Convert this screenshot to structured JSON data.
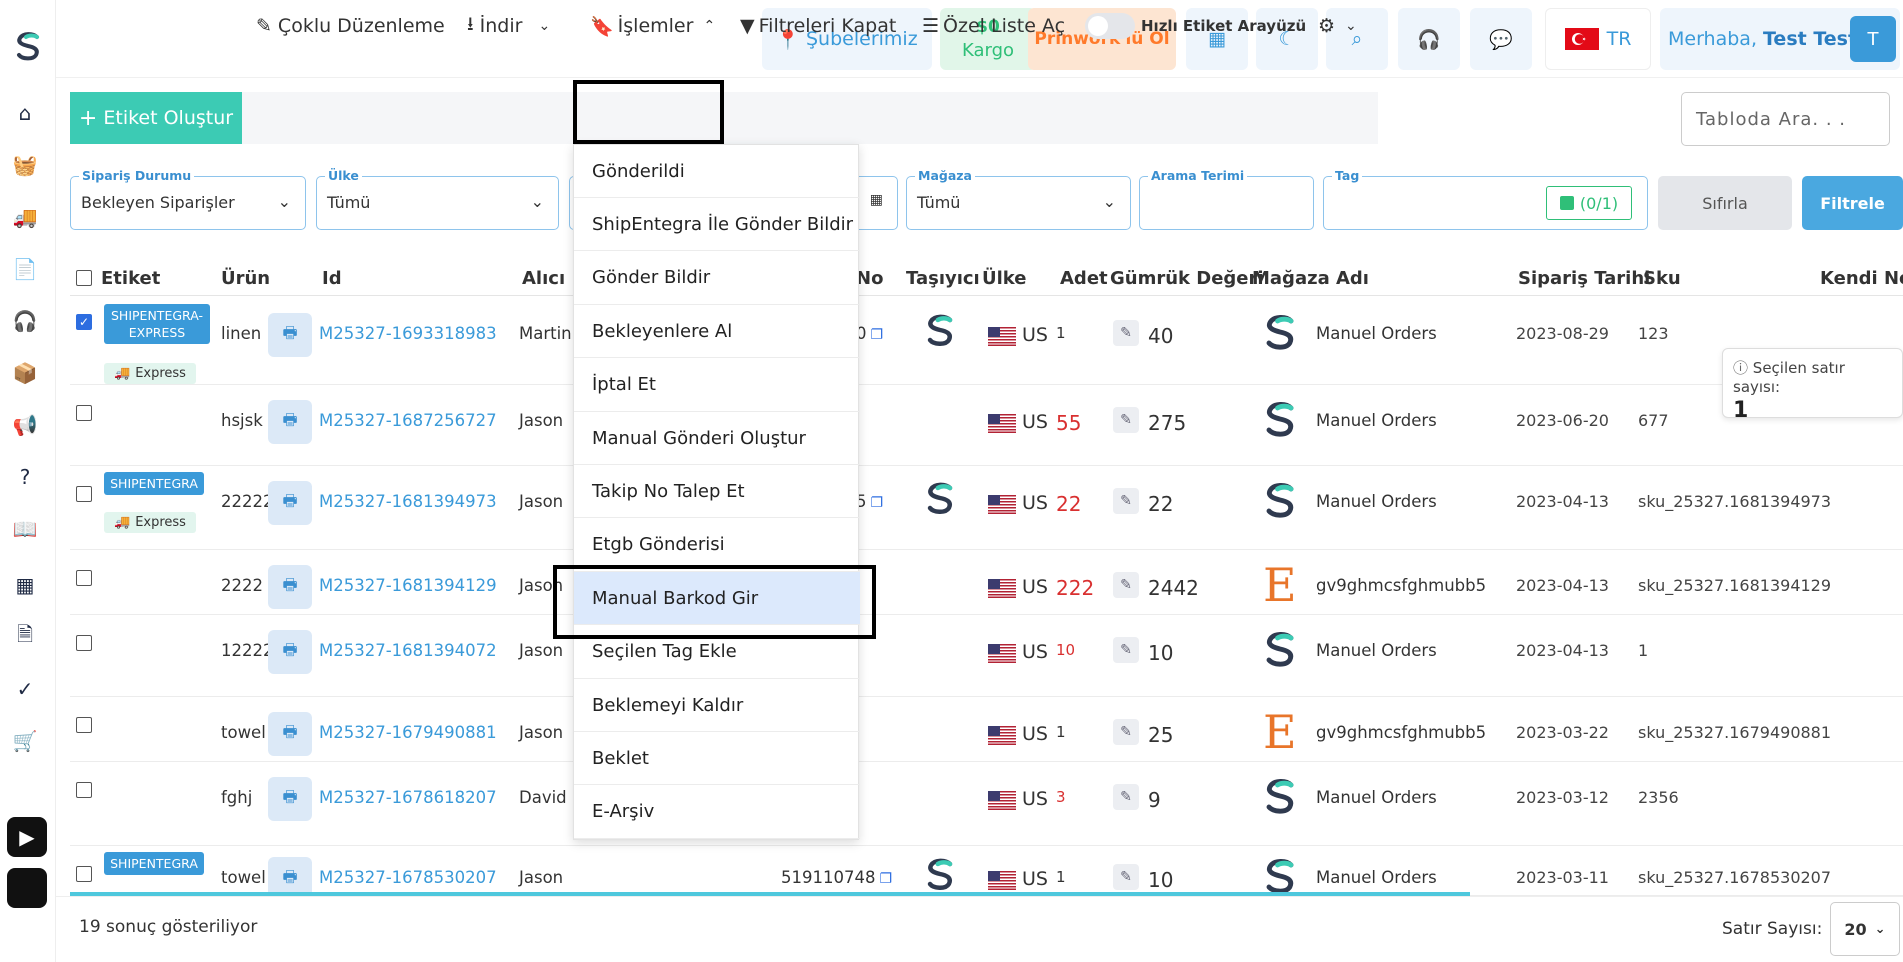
{
  "sidebar": {
    "icons": [
      "logo-icon",
      "home-icon",
      "basket-icon",
      "truck-icon",
      "document-icon",
      "headset-icon",
      "box-icon",
      "megaphone-icon",
      "help-icon",
      "book-icon",
      "calculator-icon",
      "file-icon",
      "check-icon",
      "cart-icon",
      "google-play-icon",
      "apple-icon"
    ]
  },
  "topbar": {
    "branches_label": "Şubelerimiz",
    "cargo_amount": "$0",
    "cargo_label": "Kargo",
    "prinwork_label": "Prinwork'lü Ol",
    "language": "TR",
    "greeting": "Merhaba,",
    "user_name": "Test Test",
    "avatar_initial": "T"
  },
  "toolbar": {
    "create_label": "Etiket Oluştur",
    "bulk_edit_label": "Çoklu Düzenleme",
    "download_label": "İndir",
    "actions_label": "İşlemler",
    "close_filters_label": "Filtreleri Kapat",
    "custom_list_label": "Özel Liste Aç",
    "quick_label_toggle": "Hızlı Etiket Arayüzü",
    "search_placeholder": "Tabloda Ara. . ."
  },
  "filters": {
    "order_status": {
      "label": "Sipariş Durumu",
      "value": "Bekleyen Siparişler"
    },
    "country": {
      "label": "Ülke",
      "value": "Tümü"
    },
    "store": {
      "label": "Mağaza",
      "value": "Tümü"
    },
    "search_term": {
      "label": "Arama Terimi",
      "value": ""
    },
    "tag": {
      "label": "Tag",
      "value": "(0/1)"
    },
    "reset_label": "Sıfırla",
    "filter_label": "Filtrele"
  },
  "table": {
    "headers": {
      "label": "Etiket",
      "product": "Ürün",
      "id": "Id",
      "recipient": "Alıcı",
      "tracking_no": "No",
      "carrier": "Taşıyıcı",
      "country": "Ülke",
      "quantity": "Adet",
      "customs_value": "Gümrük Değeri",
      "store_name": "Mağaza Adı",
      "order_date": "Sipariş Tarihi",
      "sku": "Sku",
      "own_note": "Kendi Not"
    },
    "rows": [
      {
        "checked": true,
        "badge": "SHIPENTEGRA-EXPRESS",
        "express": "Express",
        "product": "linen",
        "id": "M25327-1693318983",
        "recipient": "Martin",
        "tracking": "0",
        "country": "US",
        "qty": "1",
        "qty_red": false,
        "value": "40",
        "store": "Manuel Orders",
        "store_logo": "shipentegra",
        "date": "2023-08-29",
        "sku": "123"
      },
      {
        "checked": false,
        "badge": "",
        "express": "",
        "product": "hsjsk",
        "id": "M25327-1687256727",
        "recipient": "Jason",
        "tracking": "",
        "country": "US",
        "qty": "55",
        "qty_red": true,
        "value": "275",
        "store": "Manuel Orders",
        "store_logo": "shipentegra",
        "date": "2023-06-20",
        "sku": "677"
      },
      {
        "checked": false,
        "badge": "SHIPENTEGRA",
        "express": "Express",
        "product": "22222",
        "id": "M25327-1681394973",
        "recipient": "Jason",
        "tracking": "5",
        "country": "US",
        "qty": "22",
        "qty_red": true,
        "value": "22",
        "store": "Manuel Orders",
        "store_logo": "shipentegra",
        "date": "2023-04-13",
        "sku": "sku_25327.1681394973"
      },
      {
        "checked": false,
        "badge": "",
        "express": "",
        "product": "2222",
        "id": "M25327-1681394129",
        "recipient": "Jason",
        "tracking": "",
        "country": "US",
        "qty": "222",
        "qty_red": true,
        "value": "2442",
        "store": "gv9ghmcsfghmubb5",
        "store_logo": "etsy",
        "date": "2023-04-13",
        "sku": "sku_25327.1681394129"
      },
      {
        "checked": false,
        "badge": "",
        "express": "",
        "product": "12222",
        "id": "M25327-1681394072",
        "recipient": "Jason",
        "tracking": "",
        "country": "US",
        "qty": "10",
        "qty_red": true,
        "value": "10",
        "store": "Manuel Orders",
        "store_logo": "shipentegra",
        "date": "2023-04-13",
        "sku": "1"
      },
      {
        "checked": false,
        "badge": "",
        "express": "",
        "product": "towel",
        "id": "M25327-1679490881",
        "recipient": "Jason",
        "tracking": "",
        "country": "US",
        "qty": "1",
        "qty_red": false,
        "value": "25",
        "store": "gv9ghmcsfghmubb5",
        "store_logo": "etsy",
        "date": "2023-03-22",
        "sku": "sku_25327.1679490881"
      },
      {
        "checked": false,
        "badge": "",
        "express": "",
        "product": "fghj",
        "id": "M25327-1678618207",
        "recipient": "David",
        "tracking": "",
        "country": "US",
        "qty": "3",
        "qty_red": true,
        "value": "9",
        "store": "Manuel Orders",
        "store_logo": "shipentegra",
        "date": "2023-03-12",
        "sku": "2356"
      },
      {
        "checked": false,
        "badge": "SHIPENTEGRA",
        "express": "",
        "product": "towel",
        "id": "M25327-1678530207",
        "recipient": "Jason",
        "tracking": "519110748",
        "country": "US",
        "qty": "1",
        "qty_red": false,
        "value": "10",
        "store": "Manuel Orders",
        "store_logo": "shipentegra",
        "date": "2023-03-11",
        "sku": "sku_25327.1678530207"
      }
    ]
  },
  "actions_menu": {
    "items": [
      "Gönderildi",
      "ShipEntegra İle Gönder Bildir",
      "Gönder Bildir",
      "Bekleyenlere Al",
      "İptal Et",
      "Manual Gönderi Oluştur",
      "Takip No Talep Et",
      "Etgb Gönderisi",
      "Manual Barkod Gir",
      "Seçilen Tag Ekle",
      "Beklemeyi Kaldır",
      "Beklet",
      "E-Arşiv"
    ],
    "selected": "Manual Barkod Gir"
  },
  "selection_info": {
    "label": "Seçilen satır sayısı:",
    "count": "1"
  },
  "footer": {
    "results_text": "19 sonuç gösteriliyor",
    "rows_label": "Satır Sayısı:",
    "rows_value": "20"
  },
  "colors": {
    "accent": "#3a9ad9",
    "create": "#3ccbb4",
    "prinwork": "#ff7a2b",
    "etsy": "#e8752a"
  }
}
